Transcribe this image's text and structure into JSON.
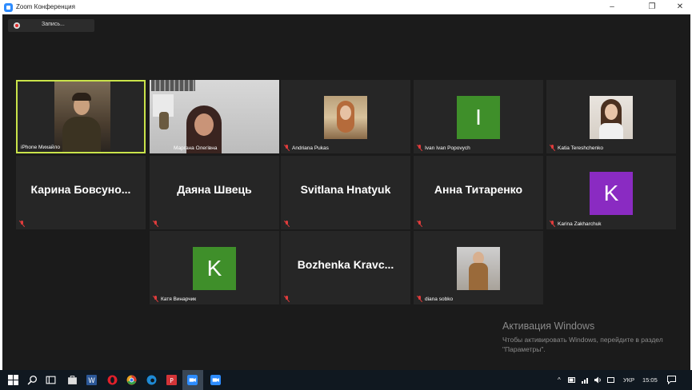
{
  "window": {
    "title": "Zoom Конференция",
    "minimize": "–",
    "restore": "❐",
    "close": "✕"
  },
  "recording": {
    "label": "Запись..."
  },
  "participants": [
    {
      "name": "iPhone Михайло",
      "kind": "video",
      "active": true
    },
    {
      "name": "Маргана Олегівна",
      "kind": "video"
    },
    {
      "name": "Andriana Pukas",
      "kind": "photo",
      "muted": true
    },
    {
      "name": "Ivan Ivan Popovych",
      "kind": "initial",
      "initial": "I",
      "color": "#3f8f2a",
      "muted": true
    },
    {
      "name": "Katia Tereshchenko",
      "kind": "photo",
      "muted": true
    },
    {
      "display": "Карина  Бовсуно...",
      "kind": "name",
      "muted": true
    },
    {
      "display": "Даяна Швець",
      "kind": "name",
      "muted": true
    },
    {
      "display": "Svitlana Hnatyuk",
      "kind": "name",
      "muted": true
    },
    {
      "display": "Анна Титаренко",
      "kind": "name",
      "muted": true
    },
    {
      "name": "Karina Zakharchuk",
      "kind": "initial",
      "initial": "K",
      "color": "#8a2bc2",
      "muted": true
    },
    {
      "name": "Катя Винарчик",
      "kind": "initial",
      "initial": "K",
      "color": "#3f8f2a",
      "muted": true
    },
    {
      "display": "Bozhenka  Kravc...",
      "kind": "name",
      "muted": true
    },
    {
      "name": "diana sobko",
      "kind": "photo",
      "muted": true
    }
  ],
  "watermark": {
    "title": "Активация Windows",
    "text": "Чтобы активировать Windows, перейдите в раздел \"Параметры\"."
  },
  "taskbar": {
    "language": "УКР",
    "time": "15:05"
  },
  "colors": {
    "active_border": "#c9e34a",
    "tile_bg": "#262626",
    "meeting_bg": "#1b1b1b"
  }
}
